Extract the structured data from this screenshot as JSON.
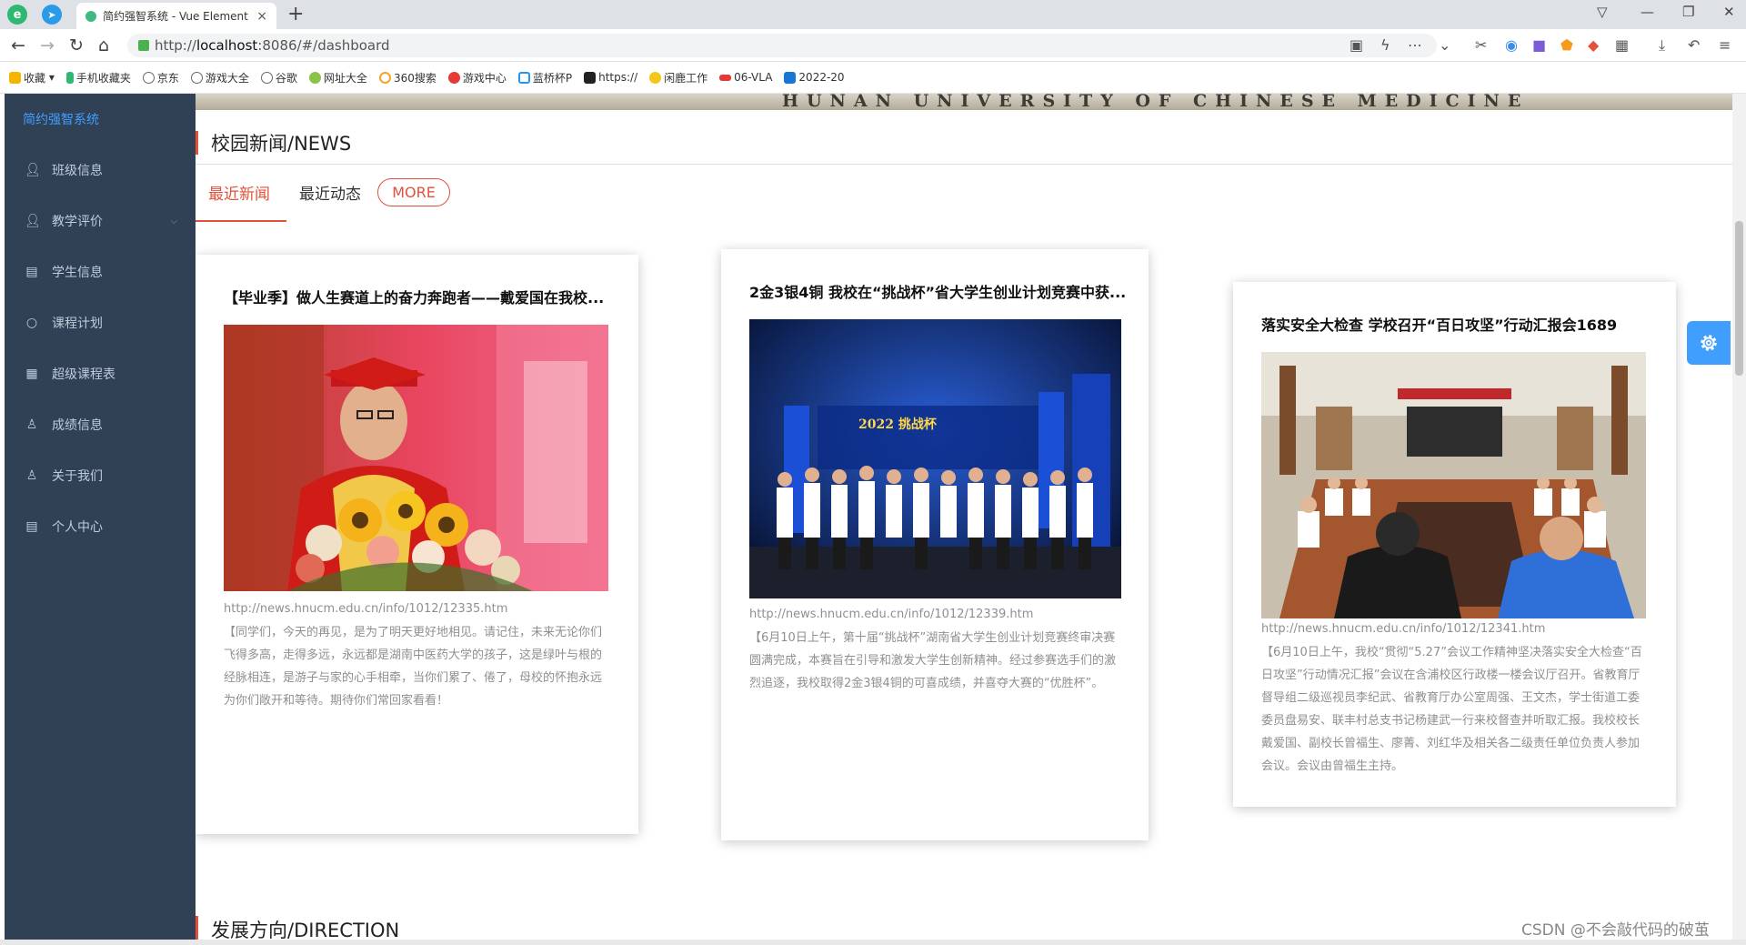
{
  "browser": {
    "tab_title": "简约强智系统 - Vue Element",
    "tab_close": "×",
    "new_tab": "+",
    "url_scheme": "http://",
    "url_host": "localhost",
    "url_rest": ":8086/#/dashboard",
    "bookmarks": [
      "收藏",
      "手机收藏夹",
      "京东",
      "游戏大全",
      "谷歌",
      "网址大全",
      "360搜索",
      "游戏中心",
      "蓝桥杯P",
      "https://",
      "闲鹿工作",
      "06-VLA",
      "2022-20"
    ]
  },
  "sidebar": {
    "brand": "简约强智系统",
    "items": [
      {
        "label": "班级信息",
        "icon": "user-icon"
      },
      {
        "label": "教学评价",
        "icon": "user-icon"
      },
      {
        "label": "学生信息",
        "icon": "building-icon"
      },
      {
        "label": "课程计划",
        "icon": "search-icon"
      },
      {
        "label": "超级课程表",
        "icon": "calendar-icon"
      },
      {
        "label": "成绩信息",
        "icon": "user-outline-icon"
      },
      {
        "label": "关于我们",
        "icon": "user-outline-icon"
      },
      {
        "label": "个人中心",
        "icon": "building-icon"
      }
    ]
  },
  "banner": {
    "text": "HUNAN UNIVERSITY OF CHINESE MEDICINE"
  },
  "news": {
    "heading": "校园新闻/NEWS",
    "tabs": [
      "最近新闻",
      "最近动态"
    ],
    "more": "MORE",
    "cards": [
      {
        "title": "【毕业季】做人生赛道上的奋力奔跑者——戴爱国在我校...",
        "link": "http://news.hnucm.edu.cn/info/1012/12335.htm",
        "desc": "【同学们，今天的再见，是为了明天更好地相见。请记住，未来无论你们飞得多高，走得多远，永远都是湖南中医药大学的孩子，这是绿叶与根的经脉相连，是游子与家的心手相牵，当你们累了、倦了，母校的怀抱永远为你们敞开和等待。期待你们常回家看看！"
      },
      {
        "title": "2金3银4铜 我校在“挑战杯”省大学生创业计划竞赛中获...",
        "link": "http://news.hnucm.edu.cn/info/1012/12339.htm",
        "desc": "【6月10日上午，第十届“挑战杯”湖南省大学生创业计划竞赛终审决赛圆满完成，本赛旨在引导和激发大学生创新精神。经过参赛选手们的激烈追逐，我校取得2金3银4铜的可喜成绩，并喜夺大赛的“优胜杯”。"
      },
      {
        "title": "落实安全大检查 学校召开“百日攻坚”行动汇报会1689",
        "link": "http://news.hnucm.edu.cn/info/1012/12341.htm",
        "desc": "【6月10日上午，我校“贯彻“5.27”会议工作精神坚决落实安全大检查“百日攻坚”行动情况汇报”会议在含浦校区行政楼一楼会议厅召开。省教育厅督导组二级巡视员李纪武、省教育厅办公室周强、王文杰，学士街道工委委员盘易安、联丰村总支书记杨建武一行来校督查并听取汇报。我校校长戴爱国、副校长曾福生、廖菁、刘红华及相关各二级责任单位负责人参加会议。会议由曾福生主持。"
      }
    ]
  },
  "direction": {
    "heading": "发展方向/DIRECTION"
  },
  "watermark": "CSDN @不会敲代码的破茧"
}
